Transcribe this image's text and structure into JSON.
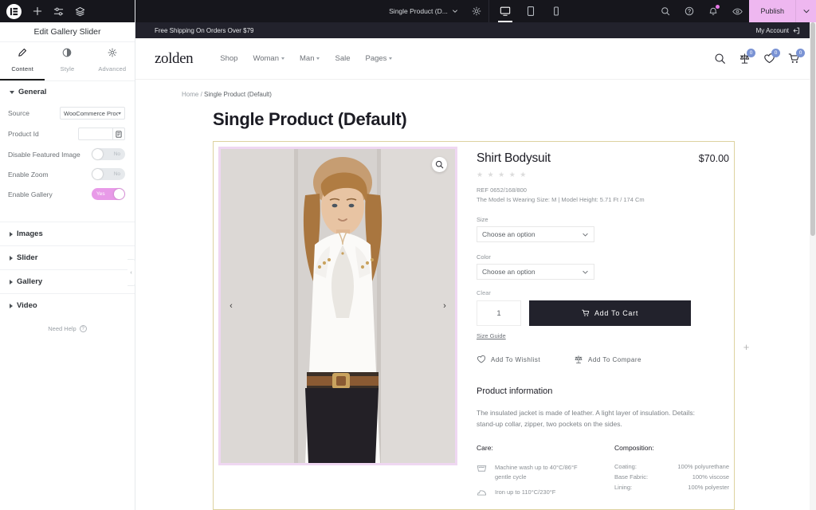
{
  "editor": {
    "topbar_icons": [
      "elementor-logo",
      "add-element-icon",
      "settings-sliders-icon",
      "layers-icon"
    ],
    "panel_title": "Edit Gallery Slider",
    "tabs": [
      {
        "label": "Content",
        "icon": "pencil-icon",
        "active": true
      },
      {
        "label": "Style",
        "icon": "contrast-circle-icon",
        "active": false
      },
      {
        "label": "Advanced",
        "icon": "gear-icon",
        "active": false
      }
    ],
    "general_section": "General",
    "controls": {
      "source_label": "Source",
      "source_value": "WooCommerce Proc",
      "product_id_label": "Product Id",
      "product_id_value": "",
      "disable_featured_label": "Disable Featured Image",
      "disable_featured_value": "No",
      "enable_zoom_label": "Enable Zoom",
      "enable_zoom_value": "No",
      "enable_gallery_label": "Enable Gallery",
      "enable_gallery_value": "Yes"
    },
    "accordions": [
      "Images",
      "Slider",
      "Gallery",
      "Video"
    ],
    "need_help": "Need Help",
    "document_name": "Single Product (D...",
    "devices": [
      "desktop-icon",
      "tablet-icon",
      "mobile-icon"
    ],
    "active_device": "desktop-icon",
    "right_icons": [
      "search-icon",
      "help-icon",
      "notifications-icon",
      "preview-eye-icon"
    ],
    "publish_label": "Publish"
  },
  "site": {
    "announcement": "Free Shipping On Orders Over $79",
    "my_account": "My Account",
    "logo": "zolden",
    "nav": [
      {
        "label": "Shop",
        "caret": false
      },
      {
        "label": "Woman",
        "caret": true
      },
      {
        "label": "Man",
        "caret": true
      },
      {
        "label": "Sale",
        "caret": false
      },
      {
        "label": "Pages",
        "caret": true
      }
    ],
    "header_icons": [
      {
        "name": "search-icon",
        "badge": null
      },
      {
        "name": "compare-icon",
        "badge": "0"
      },
      {
        "name": "wishlist-heart-icon",
        "badge": "0"
      },
      {
        "name": "cart-icon",
        "badge": "0"
      }
    ]
  },
  "page": {
    "breadcrumb_home": "Home",
    "breadcrumb_sep": " / ",
    "breadcrumb_current": "Single Product (Default)",
    "title": "Single Product (Default)"
  },
  "product": {
    "name": "Shirt Bodysuit",
    "price": "$70.00",
    "rating_stars": "★ ★ ★ ★ ★",
    "ref": "REF 0652/168/800",
    "model_note": "The Model Is Wearing Size: M | Model Height: 5.71 Ft / 174 Cm",
    "size_label": "Size",
    "size_value": "Choose an option",
    "color_label": "Color",
    "color_value": "Choose an option",
    "clear_label": "Clear",
    "quantity": "1",
    "add_to_cart": "Add To Cart",
    "size_guide": "Size Guide",
    "add_to_wishlist": "Add To Wishlist",
    "add_to_compare": "Add To Compare",
    "info_title": "Product information",
    "info_body": "The insulated jacket is made of leather. A light layer of insulation. Details: stand-up collar, zipper, two pockets on the sides.",
    "care_head": "Care:",
    "care_items": [
      {
        "icon": "washing-machine-icon",
        "text": "Machine wash up to 40°C/86°F gentle cycle"
      },
      {
        "icon": "iron-icon",
        "text": "Iron up to 110°C/230°F"
      }
    ],
    "composition_head": "Composition:",
    "composition": [
      {
        "name": "Coating:",
        "value": "100% polyurethane"
      },
      {
        "name": "Base Fabric:",
        "value": "100% viscose"
      },
      {
        "name": "Lining:",
        "value": "100% polyester"
      }
    ]
  },
  "colors": {
    "publish_bg": "#eeb7f0",
    "toggle_on": "#e89ae8",
    "section_outline": "#ddd2a0",
    "widget_outline": "#efd7f2",
    "badge": "#7a93d4",
    "dark": "#22222c"
  }
}
